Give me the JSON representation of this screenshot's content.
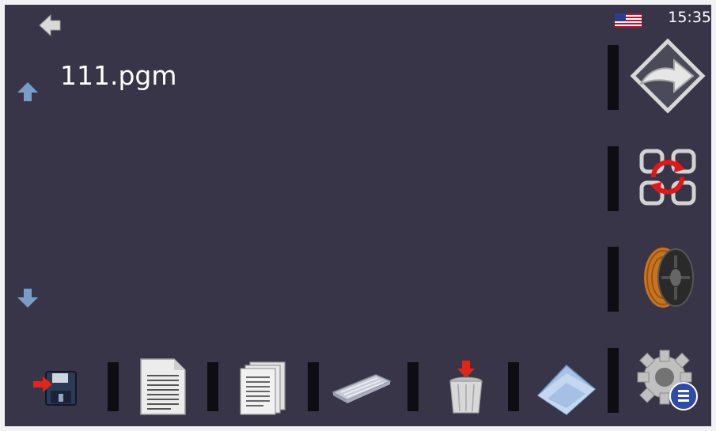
{
  "status_bar": {
    "time": "15:35",
    "language_flag_icon": "us-flag-icon"
  },
  "file_view": {
    "file_name": "111.pgm"
  },
  "icons": {
    "back": "back-arrow-icon",
    "scroll_up": "scroll-up-arrow-icon",
    "scroll_down": "scroll-down-arrow-icon",
    "side": [
      "forward-arrow-icon",
      "refresh-icon",
      "filament-spool-icon",
      "settings-gear-icon"
    ],
    "bottom": [
      "save-disk-icon",
      "document-icon",
      "documents-icon",
      "keyboard-icon",
      "trash-icon",
      "folder-icon"
    ]
  },
  "colors": {
    "background": "#373547",
    "separator": "#0e0e12",
    "text": "#ffffff",
    "accent_arrow": "#7a9cc9"
  }
}
